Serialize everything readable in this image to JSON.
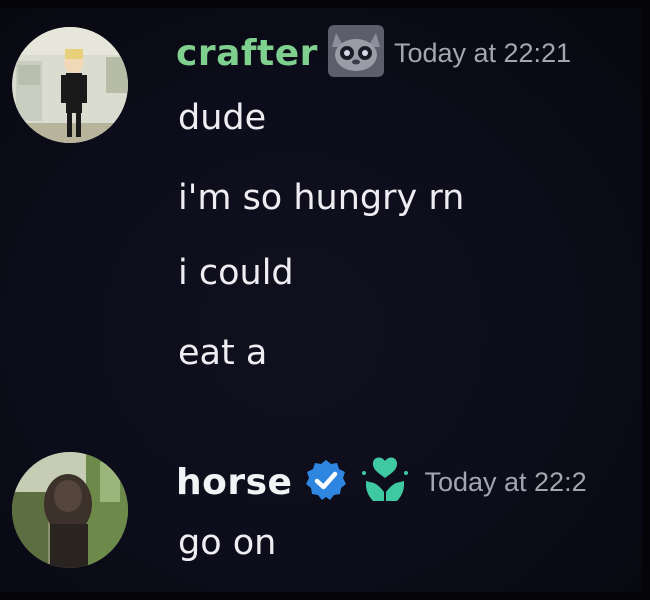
{
  "messages": [
    {
      "author": "crafter",
      "author_color": "#7fd08f",
      "timestamp": "Today at 22:21",
      "lines": [
        "dude",
        "i'm so hungry rn",
        "i could",
        "eat a"
      ]
    },
    {
      "author": "horse",
      "author_color": "#f2f3f5",
      "timestamp": "Today at 22:2",
      "lines": [
        "go on"
      ]
    }
  ],
  "colors": {
    "background": "#0c0c1a",
    "timestamp": "#a3a6b0",
    "verified_badge": "#2f86e0",
    "server_badge": "#3fc9a2"
  },
  "icons": {
    "crafter_badge": "cat-face-icon",
    "verified": "verified-check-icon",
    "server_tag": "heart-hands-icon"
  }
}
